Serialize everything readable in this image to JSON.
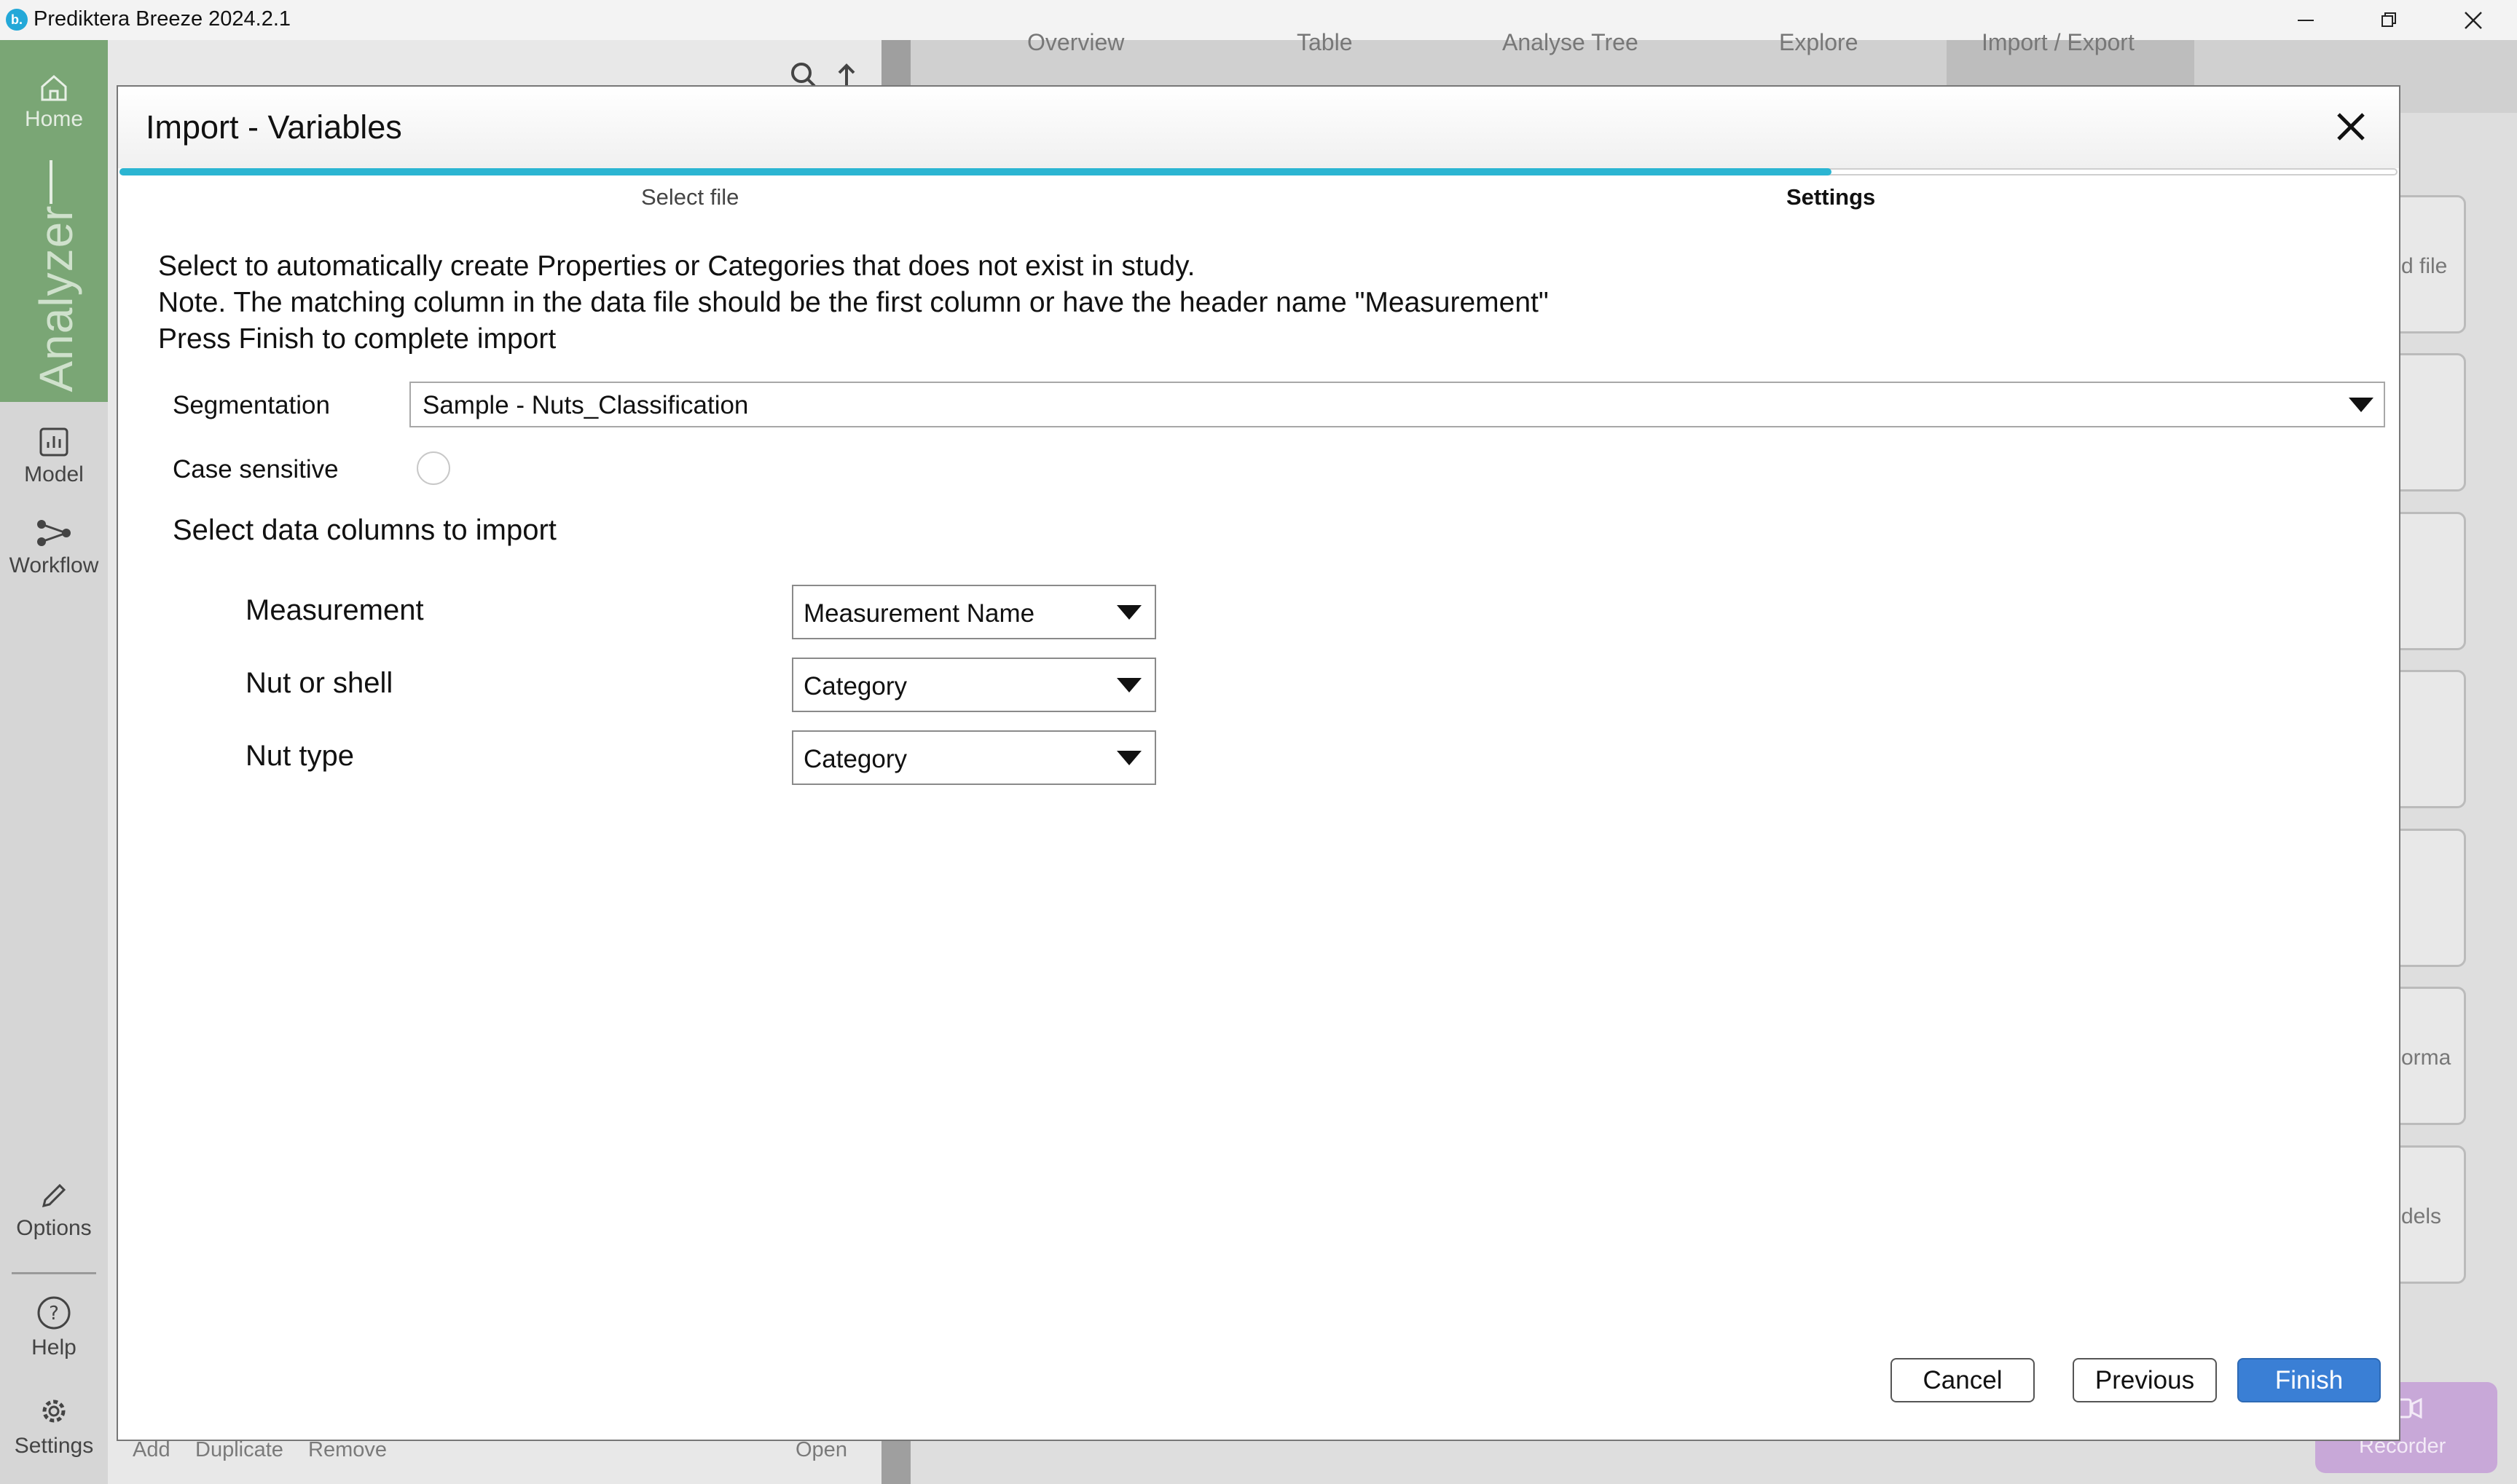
{
  "window": {
    "logo": "b.",
    "title": "Prediktera Breeze 2024.2.1"
  },
  "rail": {
    "home": "Home",
    "analyzer": "Analyzer",
    "model": "Model",
    "workflow": "Workflow",
    "options": "Options",
    "help": "Help",
    "settings": "Settings"
  },
  "background": {
    "tabs": [
      "Overview",
      "Table",
      "Analyse Tree",
      "Explore",
      "Import / Export"
    ],
    "footer": {
      "add": "Add",
      "duplicate": "Duplicate",
      "remove": "Remove",
      "open": "Open"
    },
    "cards": [
      "d file",
      "",
      "",
      "",
      "",
      "orma",
      "dels"
    ],
    "recorder": "Recorder"
  },
  "dialog": {
    "title": "Import - Variables",
    "steps": [
      "Select file",
      "Settings"
    ],
    "info": [
      "Select to automatically create Properties or Categories that does not exist in study.",
      "Note. The matching column in the data file should be the first column or have the header name \"Measurement\"",
      "Press Finish to complete import"
    ],
    "segmentation_label": "Segmentation",
    "segmentation_value": "Sample - Nuts_Classification",
    "case_sensitive_label": "Case sensitive",
    "columns_header": "Select data columns to import",
    "columns": [
      {
        "name": "Measurement",
        "type": "Measurement Name"
      },
      {
        "name": "Nut or shell",
        "type": "Category"
      },
      {
        "name": "Nut type",
        "type": "Category"
      }
    ],
    "buttons": {
      "cancel": "Cancel",
      "previous": "Previous",
      "finish": "Finish"
    },
    "progress_percent": 75
  },
  "colors": {
    "accent": "#2bb5d2",
    "primary_button": "#3a7fd5",
    "rail_green": "#7aa675"
  }
}
